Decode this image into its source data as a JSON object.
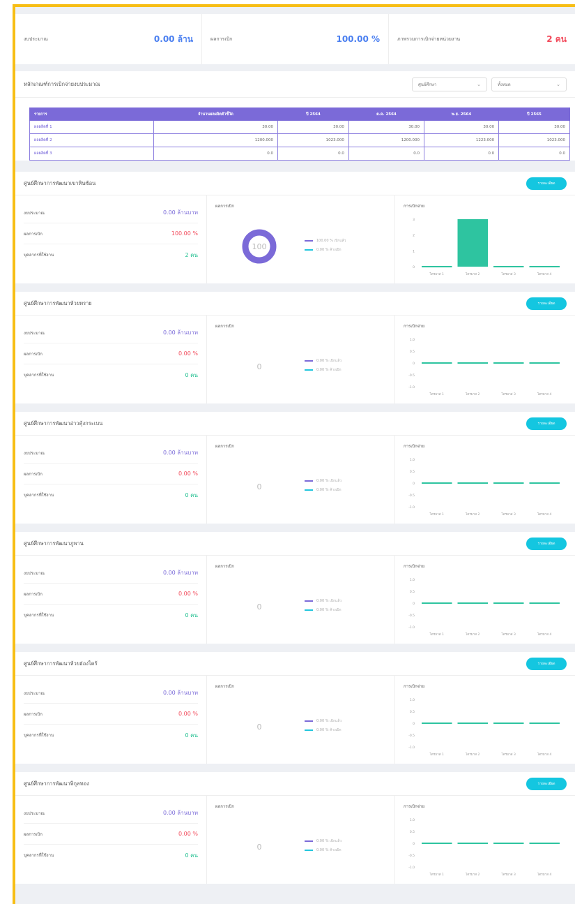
{
  "kpis": [
    {
      "label": "งบประมาณ",
      "value": "0.00 ล้าน",
      "color": "blue"
    },
    {
      "label": "ผลการเบิก",
      "value": "100.00 %",
      "color": "blue"
    },
    {
      "label": "ภาพรวมการเบิกจ่ายหน่วยงาน",
      "value": "2 คน",
      "color": "red"
    }
  ],
  "table_card": {
    "title": "หลักเกณฑ์การเบิกจ่ายงบประมาณ",
    "select1": "ศูนย์ศึกษา",
    "select2": "ทั้งหมด",
    "headers": [
      "รายการ",
      "จำนวนผลผลิตตัวชี้วัด",
      "ปี 2564",
      "ต.ค. 2564",
      "พ.ย. 2564",
      "ปี 2565"
    ],
    "rows": [
      [
        "ผลผลิตที่ 1",
        "30.00",
        "30.00",
        "30.00",
        "30.00",
        "30.00"
      ],
      [
        "ผลผลิตที่ 2",
        "1200.000",
        "1023.000",
        "1200.000",
        "1223.000",
        "1023.000"
      ],
      [
        "ผลผลิตที่ 3",
        "0.0",
        "0.0",
        "0.0",
        "0.0",
        "0.0"
      ]
    ]
  },
  "section_labels": {
    "budget": "งบประมาณ",
    "result": "ผลการเบิก",
    "people": "บุคลากรที่ใช้งาน",
    "donut_title": "ผลการเบิก",
    "bar_title": "การเบิกจ่าย",
    "button": "รายละเอียด",
    "legend_done": "เบิกแล้ว",
    "legend_pending": "ค้างเบิก",
    "quarters": [
      "ไตรมาส 1",
      "ไตรมาส 2",
      "ไตรมาส 3",
      "ไตรมาส 4"
    ]
  },
  "sections": [
    {
      "title": "ศูนย์ศึกษาการพัฒนาเขาหินซ้อน",
      "budget": "0.00 ล้านบาท",
      "percent": "100.00 %",
      "people": "2 คน",
      "donut_value": 100,
      "donut_text": "100",
      "legend1": "100.00 % เบิกแล้ว",
      "legend2": "0.00 % ค้างเบิก"
    },
    {
      "title": "ศูนย์ศึกษาการพัฒนาห้วยทราย",
      "budget": "0.00 ล้านบาท",
      "percent": "0.00 %",
      "people": "0 คน",
      "donut_value": 0,
      "donut_text": "0",
      "legend1": "0.00 % เบิกแล้ว",
      "legend2": "0.00 % ค้างเบิก"
    },
    {
      "title": "ศูนย์ศึกษาการพัฒนาอ่าวคุ้งกระเบน",
      "budget": "0.00 ล้านบาท",
      "percent": "0.00 %",
      "people": "0 คน",
      "donut_value": 0,
      "donut_text": "0",
      "legend1": "0.00 % เบิกแล้ว",
      "legend2": "0.00 % ค้างเบิก"
    },
    {
      "title": "ศูนย์ศึกษาการพัฒนาภูพาน",
      "budget": "0.00 ล้านบาท",
      "percent": "0.00 %",
      "people": "0 คน",
      "donut_value": 0,
      "donut_text": "0",
      "legend1": "0.00 % เบิกแล้ว",
      "legend2": "0.00 % ค้างเบิก"
    },
    {
      "title": "ศูนย์ศึกษาการพัฒนาห้วยฮ่องไคร้",
      "budget": "0.00 ล้านบาท",
      "percent": "0.00 %",
      "people": "0 คน",
      "donut_value": 0,
      "donut_text": "0",
      "legend1": "0.00 % เบิกแล้ว",
      "legend2": "0.00 % ค้างเบิก"
    },
    {
      "title": "ศูนย์ศึกษาการพัฒนาพิกุลทอง",
      "budget": "0.00 ล้านบาท",
      "percent": "0.00 %",
      "people": "0 คน",
      "donut_value": 0,
      "donut_text": "0",
      "legend1": "0.00 % เบิกแล้ว",
      "legend2": "0.00 % ค้างเบิก"
    }
  ],
  "chart_data": [
    {
      "type": "bar",
      "categories": [
        "ไตรมาส 1",
        "ไตรมาส 2",
        "ไตรมาส 3",
        "ไตรมาส 4"
      ],
      "values": [
        0,
        3,
        0,
        0
      ],
      "ylim": [
        0,
        3
      ],
      "yticks": [
        "0",
        "1",
        "2",
        "3"
      ],
      "color": "#2ec4a0"
    },
    {
      "type": "bar",
      "categories": [
        "ไตรมาส 1",
        "ไตรมาส 2",
        "ไตรมาส 3",
        "ไตรมาส 4"
      ],
      "values": [
        0,
        0,
        0,
        0
      ],
      "ylim": [
        -1,
        1
      ],
      "yticks": [
        "-1.0",
        "-0.5",
        "0",
        "0.5",
        "1.0"
      ],
      "color": "#2ec4a0"
    },
    {
      "type": "bar",
      "categories": [
        "ไตรมาส 1",
        "ไตรมาส 2",
        "ไตรมาส 3",
        "ไตรมาส 4"
      ],
      "values": [
        0,
        0,
        0,
        0
      ],
      "ylim": [
        -1,
        1
      ],
      "yticks": [
        "-1.0",
        "-0.5",
        "0",
        "0.5",
        "1.0"
      ],
      "color": "#2ec4a0"
    },
    {
      "type": "bar",
      "categories": [
        "ไตรมาส 1",
        "ไตรมาส 2",
        "ไตรมาส 3",
        "ไตรมาส 4"
      ],
      "values": [
        0,
        0,
        0,
        0
      ],
      "ylim": [
        -1,
        1
      ],
      "yticks": [
        "-1.0",
        "-0.5",
        "0",
        "0.5",
        "1.0"
      ],
      "color": "#2ec4a0"
    },
    {
      "type": "bar",
      "categories": [
        "ไตรมาส 1",
        "ไตรมาส 2",
        "ไตรมาส 3",
        "ไตรมาส 4"
      ],
      "values": [
        0,
        0,
        0,
        0
      ],
      "ylim": [
        -1,
        1
      ],
      "yticks": [
        "-1.0",
        "-0.5",
        "0",
        "0.5",
        "1.0"
      ],
      "color": "#2ec4a0"
    },
    {
      "type": "bar",
      "categories": [
        "ไตรมาส 1",
        "ไตรมาส 2",
        "ไตรมาส 3",
        "ไตรมาส 4"
      ],
      "values": [
        0,
        0,
        0,
        0
      ],
      "ylim": [
        -1,
        1
      ],
      "yticks": [
        "-1.0",
        "-0.5",
        "0",
        "0.5",
        "1.0"
      ],
      "color": "#2ec4a0"
    }
  ],
  "colors": {
    "accent": "#7b6ad8",
    "button": "#14c6e0",
    "bar": "#2ec4a0",
    "border": "#f7be16",
    "pending": "#22c6dd"
  }
}
